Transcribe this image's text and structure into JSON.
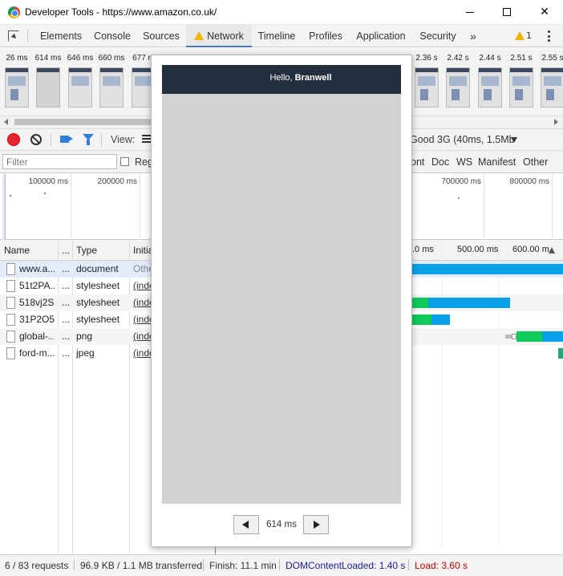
{
  "window": {
    "title": "Developer Tools - https://www.amazon.co.uk/",
    "min_label": "",
    "close_label": "✕"
  },
  "tabs": [
    {
      "label": "Elements"
    },
    {
      "label": "Console"
    },
    {
      "label": "Sources"
    },
    {
      "label": "Network",
      "active": true
    },
    {
      "label": "Timeline"
    },
    {
      "label": "Profiles"
    },
    {
      "label": "Application"
    },
    {
      "label": "Security"
    }
  ],
  "tab_more": "»",
  "warnings": {
    "count": "1"
  },
  "filmstrip": {
    "frames": [
      "26 ms",
      "614 ms",
      "646 ms",
      "660 ms",
      "677 m"
    ],
    "frames_right": [
      "2.36 s",
      "2.42 s",
      "2.44 s",
      "2.51 s",
      "2.55 s"
    ]
  },
  "toolbar": {
    "view_label": "View:",
    "throttle_label": "Good 3G (40ms, 1.5Mb"
  },
  "filterbar": {
    "placeholder": "Filter",
    "regex_label": "Reg",
    "types": [
      "ont",
      "Doc",
      "WS",
      "Manifest",
      "Other"
    ]
  },
  "overview": {
    "ticks_left": [
      "100000 ms",
      "200000 ms"
    ],
    "ticks_right": [
      "700000 ms",
      "800000 ms"
    ]
  },
  "columns": {
    "name": "Name",
    "dots": "...",
    "type": "Type",
    "initiator": "Initia",
    "wf_ticks": [
      ".0 ms",
      "500.00 ms",
      "600.00 m"
    ]
  },
  "rows": [
    {
      "name": "www.a...",
      "dots": "...",
      "type": "document",
      "initiator": "Othe"
    },
    {
      "name": "51t2PA...",
      "dots": "...",
      "type": "stylesheet",
      "initiator": "(inde"
    },
    {
      "name": "518vj2S...",
      "dots": "...",
      "type": "stylesheet",
      "initiator": "(inde"
    },
    {
      "name": "31P2O5...",
      "dots": "...",
      "type": "stylesheet",
      "initiator": "(inde"
    },
    {
      "name": "global-...",
      "dots": "...",
      "type": "png",
      "initiator": "(inde"
    },
    {
      "name": "ford-m...",
      "dots": "...",
      "type": "jpeg",
      "initiator": "(inde"
    }
  ],
  "status": {
    "requests": "6 / 83 requests",
    "transferred": "96.9 KB / 1.1 MB transferred",
    "finish": "Finish: 11.1 min",
    "dom_loaded": "DOMContentLoaded: 1.40 s",
    "load": "Load: 3.60 s",
    "dom_color": "#1a1aa6",
    "load_color": "#c80000"
  },
  "popup": {
    "greeting_prefix": "Hello, ",
    "greeting_name": "Branwell",
    "time": "614 ms"
  },
  "colors": {
    "accent": "#3879d9",
    "waterfall_green": "#0fcb5c",
    "waterfall_blue": "#0ba1ea",
    "amazon_header": "#232f3e"
  }
}
